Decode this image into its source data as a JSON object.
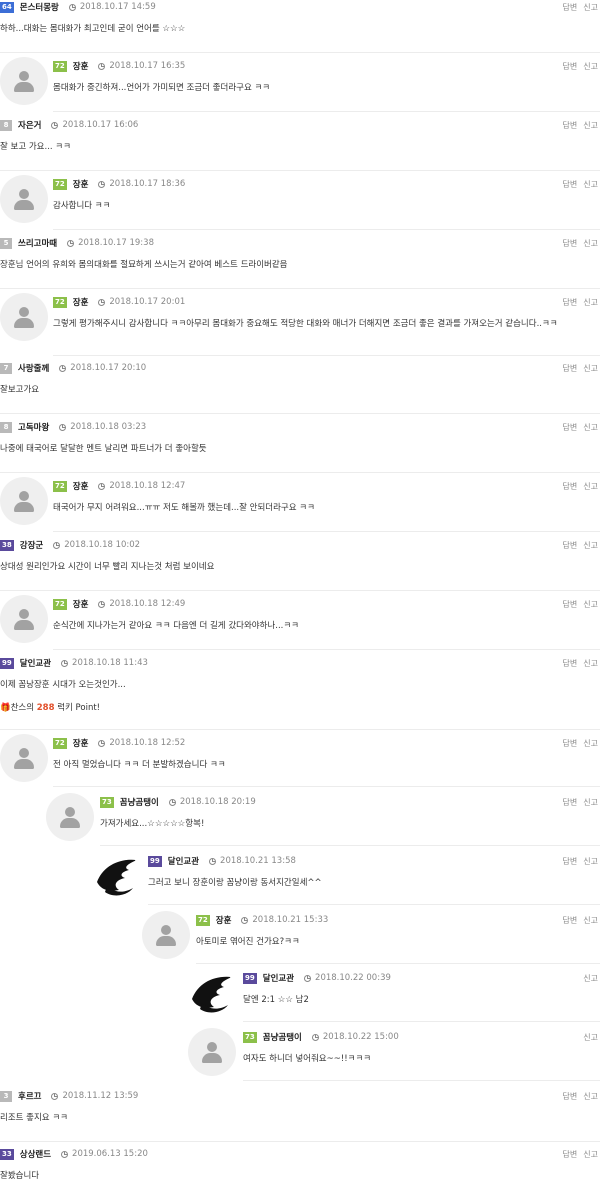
{
  "actions": {
    "reply": "답변",
    "report": "신고"
  },
  "colors": {
    "lvl_green": "#8cc04a",
    "lvl_purple": "#5a4a9c",
    "lvl_gray": "#b9b9b9",
    "lvl_blue": "#3c6ed6",
    "point": "#e2502b"
  },
  "comments": [
    {
      "level": "64",
      "nick": "몬스터몽랑",
      "date": "2018.10.17 14:59",
      "text": "하하...대화는 몸대화가 최고인데 굳이 언어를 ☆☆☆"
    },
    {
      "level": "72",
      "nick": "장훈",
      "date": "2018.10.17 16:35",
      "text": "몸대화가 중긴하져...언어가 가미되면 조금더 좋더라구요 ㅋㅋ"
    },
    {
      "level": "8",
      "nick": "자은거",
      "date": "2018.10.17 16:06",
      "text": "잘 보고 가요... ㅋㅋ"
    },
    {
      "level": "72",
      "nick": "장훈",
      "date": "2018.10.17 18:36",
      "text": "감사합니다 ㅋㅋ"
    },
    {
      "level": "5",
      "nick": "쓰리고마때",
      "date": "2018.10.17 19:38",
      "text": "장훈님 언어의 유희와 몸의대화를 절묘하게 쓰시는거 같아여 베스트 드라이버같음"
    },
    {
      "level": "72",
      "nick": "장훈",
      "date": "2018.10.17 20:01",
      "text": "그렇게 평가해주시니 감사합니다 ㅋㅋ아무리 몸대화가 중요해도 적당한 대화와 매너가 더해지면 조금더 좋은 결과를 가져오는거 같습니다..ㅋㅋ"
    },
    {
      "level": "7",
      "nick": "사랑줄께",
      "date": "2018.10.17 20:10",
      "text": "잘보고가요"
    },
    {
      "level": "8",
      "nick": "고독마왕",
      "date": "2018.10.18 03:23",
      "text": "나중에 태국어로 달달한 멘트 날리면 파트너가 더 좋아할듯"
    },
    {
      "level": "72",
      "nick": "장훈",
      "date": "2018.10.18 12:47",
      "text": "태국어가 무지 어려워요...ㅠㅠ 저도 해볼까 했는데...잘 안되더라구요 ㅋㅋ"
    },
    {
      "level": "38",
      "nick": "강장군",
      "date": "2018.10.18 10:02",
      "text": "상대성 원리인가요 시간이 너무 빨리 지나는것 처럼 보이네요"
    },
    {
      "level": "72",
      "nick": "장훈",
      "date": "2018.10.18 12:49",
      "text": "순식간에 지나가는거 같아요 ㅋㅋ 다음엔 더 길게 갔다와야하나...ㅋㅋ"
    },
    {
      "level": "99",
      "nick": "달인교관",
      "date": "2018.10.18 11:43",
      "text": "이제 꼼낭장훈 시대가 오는것인가...",
      "bonus_pre": "찬스의 ",
      "bonus_pts": "288",
      "bonus_post": " 럭키 Point!"
    },
    {
      "level": "72",
      "nick": "장훈",
      "date": "2018.10.18 12:52",
      "text": "전 아직 멀었습니다 ㅋㅋ 더 분발하겠습니다 ㅋㅋ"
    },
    {
      "level": "73",
      "nick": "꼼냥곰탱이",
      "date": "2018.10.18 20:19",
      "text": "가져가세요...☆☆☆☆☆항복!"
    },
    {
      "level": "99",
      "nick": "달인교관",
      "date": "2018.10.21 13:58",
      "text": "그러고 보니 장훈이랑 꼼냥이랑 동서지간일세^^"
    },
    {
      "level": "72",
      "nick": "장훈",
      "date": "2018.10.21 15:33",
      "text": "아토미로 엮어진 건가요?ㅋㅋ"
    },
    {
      "level": "99",
      "nick": "달인교관",
      "date": "2018.10.22 00:39",
      "text": "달엔 2:1 ☆☆ 남2"
    },
    {
      "level": "73",
      "nick": "꼼냥곰탱이",
      "date": "2018.10.22 15:00",
      "text": "여자도 하니더 넣어줘요~~!!ㅋㅋㅋ"
    },
    {
      "level": "3",
      "nick": "후르끄",
      "date": "2018.11.12 13:59",
      "text": "리조트 좋지요 ㅋㅋ"
    },
    {
      "level": "33",
      "nick": "상상랜드",
      "date": "2019.06.13 15:20",
      "text": "잘봤습니다"
    }
  ]
}
